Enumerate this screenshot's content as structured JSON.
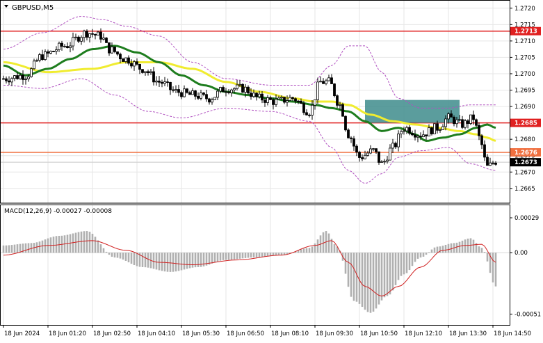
{
  "chart_data": {
    "type": "candlestick",
    "symbol_label": "GBPUSD,M5",
    "macd_label": "MACD(12,26,9) -0.00027 -0.00008",
    "price_axis": {
      "range": [
        1.26605,
        1.27225
      ],
      "ticks": [
        "1.2720",
        "1.2715",
        "1.2710",
        "1.2705",
        "1.2700",
        "1.2695",
        "1.2690",
        "1.2685",
        "1.2680",
        "1.2675",
        "1.2670",
        "1.2665"
      ],
      "tick_values": [
        1.272,
        1.2715,
        1.271,
        1.2705,
        1.27,
        1.2695,
        1.269,
        1.2685,
        1.268,
        1.2675,
        1.267,
        1.2665
      ]
    },
    "macd_axis": {
      "range": [
        -0.0006,
        0.0004
      ],
      "ticks": [
        "0.00029",
        "0.00",
        "-0.00051"
      ],
      "tick_values": [
        0.00029,
        0.0,
        -0.00051
      ]
    },
    "time_labels": [
      "18 Jun 2024",
      "18 Jun 01:20",
      "18 Jun 02:50",
      "18 Jun 04:10",
      "18 Jun 05:30",
      "18 Jun 06:50",
      "18 Jun 08:10",
      "18 Jun 09:30",
      "18 Jun 10:50",
      "18 Jun 12:10",
      "18 Jun 13:30",
      "18 Jun 14:50"
    ],
    "time_label_index": [
      0,
      16,
      32,
      48,
      64,
      80,
      96,
      112,
      128,
      144,
      160,
      176
    ],
    "candle_count": 178,
    "candle_anchors": [
      [
        0,
        1.26985
      ],
      [
        8,
        1.26995
      ],
      [
        14,
        1.27055
      ],
      [
        22,
        1.27085
      ],
      [
        30,
        1.27125
      ],
      [
        35,
        1.27115
      ],
      [
        38,
        1.27075
      ],
      [
        44,
        1.27045
      ],
      [
        50,
        1.27015
      ],
      [
        56,
        1.26975
      ],
      [
        62,
        1.26945
      ],
      [
        68,
        1.26935
      ],
      [
        74,
        1.26925
      ],
      [
        80,
        1.26955
      ],
      [
        86,
        1.26955
      ],
      [
        92,
        1.26925
      ],
      [
        98,
        1.26915
      ],
      [
        104,
        1.26925
      ],
      [
        110,
        1.26885
      ],
      [
        114,
        1.26975
      ],
      [
        117,
        1.26975
      ],
      [
        121,
        1.26905
      ],
      [
        124,
        1.26815
      ],
      [
        128,
        1.26745
      ],
      [
        133,
        1.26765
      ],
      [
        136,
        1.26725
      ],
      [
        140,
        1.26775
      ],
      [
        144,
        1.26835
      ],
      [
        150,
        1.26815
      ],
      [
        156,
        1.26835
      ],
      [
        160,
        1.26865
      ],
      [
        165,
        1.26845
      ],
      [
        169,
        1.26865
      ],
      [
        171,
        1.26805
      ],
      [
        174,
        1.26715
      ],
      [
        177,
        1.26733
      ]
    ],
    "ema_green_anchors": [
      [
        0,
        1.27025
      ],
      [
        8,
        1.26995
      ],
      [
        16,
        1.27015
      ],
      [
        24,
        1.27045
      ],
      [
        32,
        1.27075
      ],
      [
        40,
        1.27085
      ],
      [
        48,
        1.27065
      ],
      [
        56,
        1.27035
      ],
      [
        64,
        1.26995
      ],
      [
        72,
        1.26965
      ],
      [
        80,
        1.26945
      ],
      [
        88,
        1.26935
      ],
      [
        96,
        1.26925
      ],
      [
        104,
        1.26915
      ],
      [
        112,
        1.26905
      ],
      [
        118,
        1.26895
      ],
      [
        124,
        1.26885
      ],
      [
        130,
        1.26855
      ],
      [
        136,
        1.26825
      ],
      [
        142,
        1.26835
      ],
      [
        148,
        1.26815
      ],
      [
        152,
        1.26795
      ],
      [
        158,
        1.26805
      ],
      [
        164,
        1.26815
      ],
      [
        170,
        1.26835
      ],
      [
        174,
        1.26845
      ],
      [
        177,
        1.26835
      ]
    ],
    "ema_yellow_anchors": [
      [
        0,
        1.27035
      ],
      [
        16,
        1.27005
      ],
      [
        32,
        1.27015
      ],
      [
        44,
        1.27035
      ],
      [
        56,
        1.27035
      ],
      [
        68,
        1.27015
      ],
      [
        80,
        1.26975
      ],
      [
        92,
        1.26945
      ],
      [
        104,
        1.26925
      ],
      [
        112,
        1.26915
      ],
      [
        118,
        1.26915
      ],
      [
        124,
        1.26905
      ],
      [
        132,
        1.26875
      ],
      [
        140,
        1.26855
      ],
      [
        148,
        1.26845
      ],
      [
        156,
        1.26835
      ],
      [
        164,
        1.26825
      ],
      [
        170,
        1.26815
      ],
      [
        174,
        1.26805
      ],
      [
        177,
        1.26795
      ]
    ],
    "bollinger_upper_anchors": [
      [
        0,
        1.27075
      ],
      [
        14,
        1.27125
      ],
      [
        28,
        1.27175
      ],
      [
        36,
        1.27165
      ],
      [
        44,
        1.27145
      ],
      [
        56,
        1.27115
      ],
      [
        68,
        1.27035
      ],
      [
        80,
        1.26985
      ],
      [
        96,
        1.26965
      ],
      [
        110,
        1.26965
      ],
      [
        118,
        1.27025
      ],
      [
        124,
        1.27085
      ],
      [
        130,
        1.27085
      ],
      [
        136,
        1.27005
      ],
      [
        142,
        1.26925
      ],
      [
        150,
        1.26895
      ],
      [
        160,
        1.26895
      ],
      [
        168,
        1.26905
      ],
      [
        177,
        1.26905
      ]
    ],
    "bollinger_lower_anchors": [
      [
        0,
        1.26965
      ],
      [
        14,
        1.26955
      ],
      [
        28,
        1.26985
      ],
      [
        40,
        1.26935
      ],
      [
        52,
        1.26885
      ],
      [
        64,
        1.26865
      ],
      [
        80,
        1.26895
      ],
      [
        96,
        1.26885
      ],
      [
        110,
        1.26855
      ],
      [
        118,
        1.26775
      ],
      [
        124,
        1.26705
      ],
      [
        130,
        1.26665
      ],
      [
        136,
        1.26695
      ],
      [
        142,
        1.26745
      ],
      [
        150,
        1.26765
      ],
      [
        160,
        1.26775
      ],
      [
        168,
        1.26725
      ],
      [
        177,
        1.26705
      ]
    ],
    "macd_hist_anchors": [
      [
        0,
        6e-05
      ],
      [
        10,
        8e-05
      ],
      [
        20,
        0.00014
      ],
      [
        30,
        0.00018
      ],
      [
        40,
        -4e-05
      ],
      [
        50,
        -0.00012
      ],
      [
        60,
        -0.00016
      ],
      [
        70,
        -0.00012
      ],
      [
        80,
        -6e-05
      ],
      [
        90,
        -4e-05
      ],
      [
        100,
        -2e-05
      ],
      [
        110,
        4e-05
      ],
      [
        116,
        0.00018
      ],
      [
        120,
        5e-05
      ],
      [
        126,
        -0.0004
      ],
      [
        132,
        -0.0005
      ],
      [
        138,
        -0.00036
      ],
      [
        144,
        -0.00018
      ],
      [
        150,
        -4e-05
      ],
      [
        156,
        5e-05
      ],
      [
        162,
        8e-05
      ],
      [
        168,
        0.00012
      ],
      [
        172,
        4e-05
      ],
      [
        177,
        -0.00028
      ]
    ],
    "macd_signal_anchors": [
      [
        0,
        -2e-05
      ],
      [
        16,
        6e-05
      ],
      [
        32,
        0.0001
      ],
      [
        44,
        2e-05
      ],
      [
        56,
        -8e-05
      ],
      [
        68,
        -0.0001
      ],
      [
        84,
        -6e-05
      ],
      [
        100,
        -2e-05
      ],
      [
        112,
        6e-05
      ],
      [
        118,
        0.0001
      ],
      [
        124,
        -8e-05
      ],
      [
        130,
        -0.00028
      ],
      [
        136,
        -0.00036
      ],
      [
        142,
        -0.00028
      ],
      [
        150,
        -0.00012
      ],
      [
        158,
        2e-05
      ],
      [
        166,
        6e-05
      ],
      [
        172,
        7e-05
      ],
      [
        177,
        -8e-05
      ]
    ],
    "horizontal_levels": [
      {
        "label": "1.2713",
        "value": 1.2713,
        "color": "#e02020"
      },
      {
        "label": "1.2685",
        "value": 1.2685,
        "color": "#e02020"
      },
      {
        "label": "1.2676",
        "value": 1.2676,
        "color": "#f07040"
      }
    ],
    "current_price": {
      "label": "1.2673",
      "value": 1.2673
    },
    "box": {
      "start_index": 130,
      "end_index": 164,
      "top": 1.2692,
      "bottom": 1.2685,
      "color": "#3e8c8c"
    },
    "colors": {
      "candle": "#000000",
      "ema_fast": "#1e7d1e",
      "ema_slow": "#f0ec30",
      "bands": "#b050c0",
      "macd_hist": "#b0b0b0",
      "macd_signal": "#d02020",
      "grid": "#e6e6e6"
    },
    "grid": true
  }
}
